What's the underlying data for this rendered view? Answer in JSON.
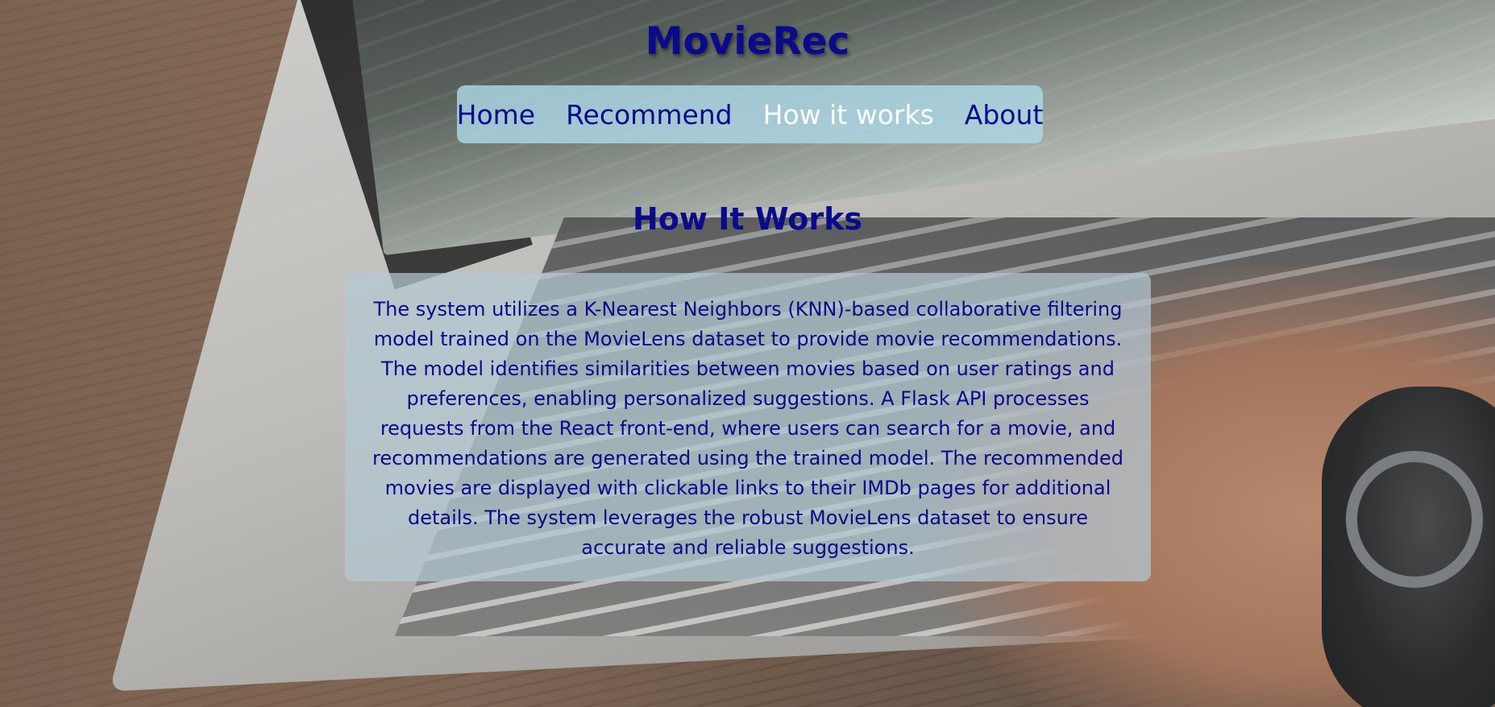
{
  "site": {
    "title": "MovieRec"
  },
  "nav": {
    "items": [
      {
        "label": "Home",
        "active": false
      },
      {
        "label": "Recommend",
        "active": false
      },
      {
        "label": "How it works",
        "active": true
      },
      {
        "label": "About",
        "active": false
      }
    ]
  },
  "main": {
    "heading": "How It Works",
    "description": "The system utilizes a K-Nearest Neighbors (KNN)-based collaborative filtering model trained on the MovieLens dataset to provide movie recommendations. The model identifies similarities between movies based on user ratings and preferences, enabling personalized suggestions. A Flask API processes requests from the React front-end, where users can search for a movie, and recommendations are generated using the trained model. The recommended movies are displayed with clickable links to their IMDb pages for additional details. The system leverages the robust MovieLens dataset to ensure accurate and reliable suggestions."
  },
  "theme": {
    "text_color": "#0a0a8a",
    "active_nav_color": "#ffffff",
    "nav_background": "#add8e6",
    "card_background": "#b4c8d2"
  }
}
